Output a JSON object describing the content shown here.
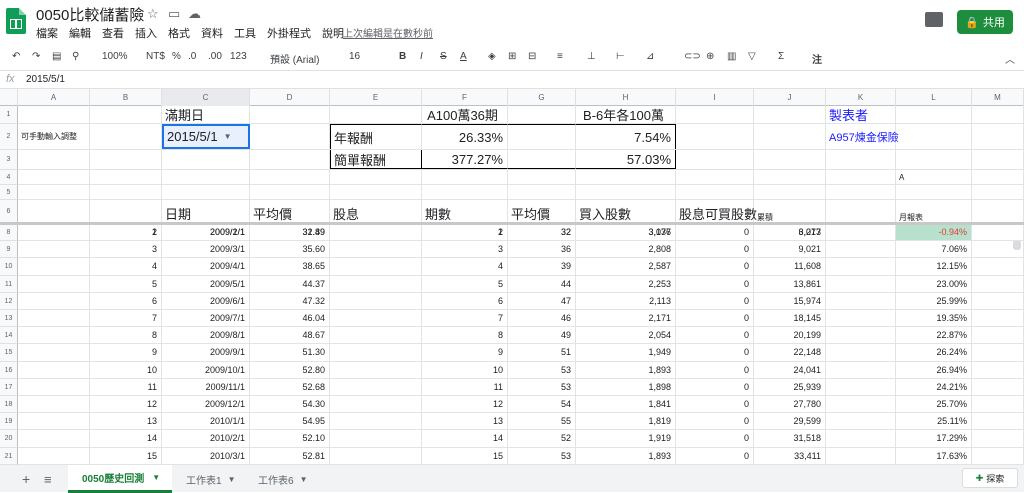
{
  "doc": {
    "title": "0050比較儲蓄險",
    "menu": [
      "檔案",
      "編輯",
      "查看",
      "插入",
      "格式",
      "資料",
      "工具",
      "外掛程式",
      "說明"
    ],
    "last_edit": "上次編輯是在數秒前",
    "share": "共用"
  },
  "toolbar": {
    "zoom": "100%",
    "currency": "NT$",
    "percent": "%",
    "dec_less": ".0",
    "dec_more": ".00",
    "format_more": "123",
    "font": "預設 (Arial)",
    "size": "16",
    "bold": "B",
    "italic": "I",
    "strike": "S",
    "color_a": "A",
    "sum": "Σ",
    "note": "注"
  },
  "fbar": {
    "fx": "fx",
    "value": "2015/5/1"
  },
  "columns": [
    "A",
    "B",
    "C",
    "D",
    "E",
    "F",
    "G",
    "H",
    "I",
    "J",
    "K",
    "L",
    "M"
  ],
  "row_numbers": [
    "1",
    "2",
    "3",
    "4",
    "5",
    "6",
    "7",
    "8",
    "9",
    "10",
    "11",
    "12",
    "13",
    "14",
    "15",
    "16",
    "17",
    "18",
    "19",
    "20",
    "21"
  ],
  "top": {
    "c1": "滿期日",
    "c2": "2015/5/1",
    "f1": "A100萬36期",
    "h1": "B-6年各100萬",
    "a2": "可手動輸入調整",
    "e2": "年報酬",
    "f2": "26.33%",
    "h2": "7.54%",
    "e3": "簡單報酬",
    "f3": "377.27%",
    "h3": "57.03%",
    "k1": "製表者",
    "k2": "A957煉金保險",
    "l4": "A",
    "h6": [
      "日期",
      "平均價",
      "股息",
      "期數",
      "平均價",
      "買入股數",
      "股息可買股數",
      "累積",
      "月報表"
    ]
  },
  "rows": [
    {
      "b": "1",
      "c": "2009/1/1",
      "d": "32.49",
      "f": "1",
      "g": "32",
      "h": "3,077",
      "i": "",
      "j": "3,077",
      "l": ""
    },
    {
      "b": "2",
      "c": "2009/2/1",
      "d": "31.89",
      "f": "2",
      "g": "32",
      "h": "3,136",
      "i": "0",
      "j": "6,213",
      "l": "-0.94%"
    },
    {
      "b": "3",
      "c": "2009/3/1",
      "d": "35.60",
      "f": "3",
      "g": "36",
      "h": "2,808",
      "i": "0",
      "j": "9,021",
      "l": "7.06%"
    },
    {
      "b": "4",
      "c": "2009/4/1",
      "d": "38.65",
      "f": "4",
      "g": "39",
      "h": "2,587",
      "i": "0",
      "j": "11,608",
      "l": "12.15%"
    },
    {
      "b": "5",
      "c": "2009/5/1",
      "d": "44.37",
      "f": "5",
      "g": "44",
      "h": "2,253",
      "i": "0",
      "j": "13,861",
      "l": "23.00%"
    },
    {
      "b": "6",
      "c": "2009/6/1",
      "d": "47.32",
      "f": "6",
      "g": "47",
      "h": "2,113",
      "i": "0",
      "j": "15,974",
      "l": "25.99%"
    },
    {
      "b": "7",
      "c": "2009/7/1",
      "d": "46.04",
      "f": "7",
      "g": "46",
      "h": "2,171",
      "i": "0",
      "j": "18,145",
      "l": "19.35%"
    },
    {
      "b": "8",
      "c": "2009/8/1",
      "d": "48.67",
      "f": "8",
      "g": "49",
      "h": "2,054",
      "i": "0",
      "j": "20,199",
      "l": "22.87%"
    },
    {
      "b": "9",
      "c": "2009/9/1",
      "d": "51.30",
      "f": "9",
      "g": "51",
      "h": "1,949",
      "i": "0",
      "j": "22,148",
      "l": "26.24%"
    },
    {
      "b": "10",
      "c": "2009/10/1",
      "d": "52.80",
      "f": "10",
      "g": "53",
      "h": "1,893",
      "i": "0",
      "j": "24,041",
      "l": "26.94%"
    },
    {
      "b": "11",
      "c": "2009/11/1",
      "d": "52.68",
      "f": "11",
      "g": "53",
      "h": "1,898",
      "i": "0",
      "j": "25,939",
      "l": "24.21%"
    },
    {
      "b": "12",
      "c": "2009/12/1",
      "d": "54.30",
      "f": "12",
      "g": "54",
      "h": "1,841",
      "i": "0",
      "j": "27,780",
      "l": "25.70%"
    },
    {
      "b": "13",
      "c": "2010/1/1",
      "d": "54.95",
      "f": "13",
      "g": "55",
      "h": "1,819",
      "i": "0",
      "j": "29,599",
      "l": "25.11%"
    },
    {
      "b": "14",
      "c": "2010/2/1",
      "d": "52.10",
      "f": "14",
      "g": "52",
      "h": "1,919",
      "i": "0",
      "j": "31,518",
      "l": "17.29%"
    },
    {
      "b": "15",
      "c": "2010/3/1",
      "d": "52.81",
      "f": "15",
      "g": "53",
      "h": "1,893",
      "i": "0",
      "j": "33,411",
      "l": "17.63%"
    }
  ],
  "tabs": {
    "add": "+",
    "list": "≡",
    "active": "0050歷史回測",
    "t2": "工作表1",
    "t3": "工作表6",
    "explore": "探索"
  },
  "colors": {
    "green": "#0f9d58",
    "neg_bg": "#b7e1cd",
    "red": "#e53935",
    "blue": "#1a1aff"
  }
}
